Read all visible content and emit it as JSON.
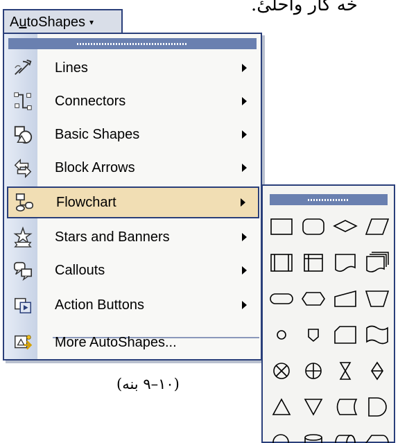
{
  "page_text": {
    "top_arabic": "خه کار واحلیٔ.",
    "caption": "(۱۰–۹ بنه)"
  },
  "autoshapes_button": {
    "label_prefix": "A",
    "label_underlined": "u",
    "label_rest": "toShapes",
    "arrow": "▾"
  },
  "menu": {
    "items": [
      {
        "label": "Lines",
        "icon": "lines-icon",
        "submenu": true
      },
      {
        "label": "Connectors",
        "icon": "connectors-icon",
        "submenu": true
      },
      {
        "label": "Basic Shapes",
        "icon": "basic-shapes-icon",
        "submenu": true
      },
      {
        "label": "Block Arrows",
        "icon": "block-arrows-icon",
        "submenu": true
      },
      {
        "label": "Flowchart",
        "icon": "flowchart-icon",
        "submenu": true,
        "highlighted": true
      },
      {
        "label": "Stars and Banners",
        "icon": "stars-banners-icon",
        "submenu": true
      },
      {
        "label": "Callouts",
        "icon": "callouts-icon",
        "submenu": true
      },
      {
        "label": "Action Buttons",
        "icon": "action-buttons-icon",
        "submenu": true
      },
      {
        "label": "More AutoShapes...",
        "icon": "more-autoshapes-icon",
        "submenu": false
      }
    ]
  },
  "flowchart_palette": {
    "shapes": [
      "process",
      "alternate-process",
      "decision",
      "data",
      "predefined-process",
      "internal-storage",
      "document",
      "multidocument",
      "terminator",
      "preparation",
      "manual-input",
      "manual-operation",
      "connector",
      "off-page-connector",
      "card",
      "punched-tape",
      "summing-junction",
      "or",
      "collate",
      "sort",
      "extract",
      "merge",
      "stored-data",
      "delay",
      "sequential-access-storage",
      "magnetic-disk",
      "direct-access-storage",
      "display"
    ]
  },
  "colors": {
    "menu_border": "#2a3f7a",
    "highlight": "#f1deb4",
    "gutter": "#c8d3e6",
    "drag_bar": "#6a80b0"
  }
}
